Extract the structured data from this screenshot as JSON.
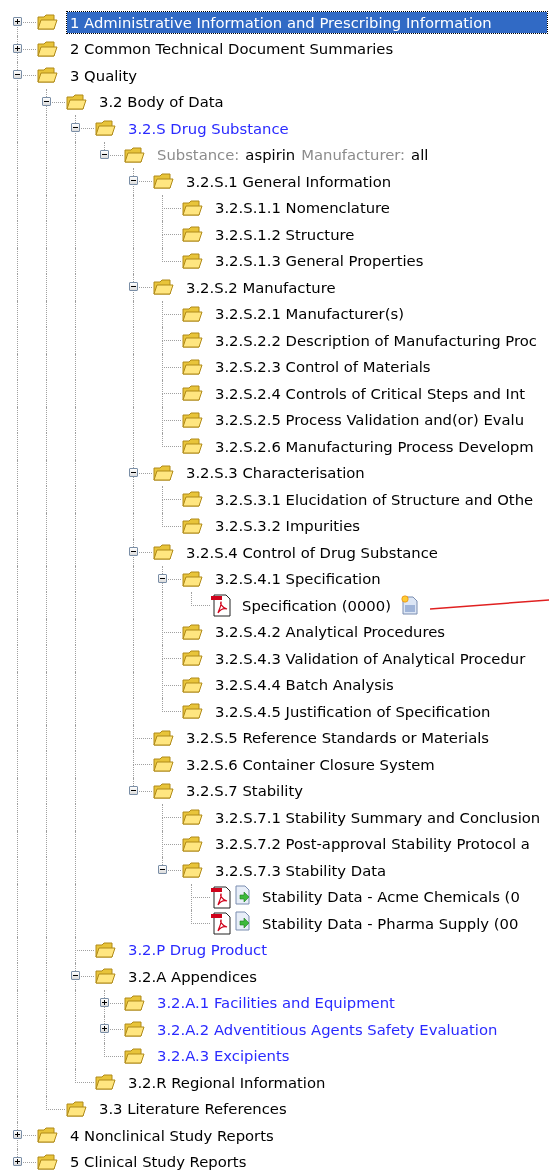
{
  "tree": [
    {
      "kind": "folder",
      "label": "1 Administrative Information and Prescribing Information",
      "selected": true,
      "emphasized": false,
      "expanded": false
    },
    {
      "kind": "folder",
      "label": "2 Common Technical Document Summaries",
      "selected": false,
      "emphasized": false,
      "expanded": false
    },
    {
      "kind": "folder",
      "label": "3 Quality",
      "selected": false,
      "emphasized": false,
      "expanded": true,
      "children": [
        {
          "kind": "folder",
          "label": "3.2 Body of Data",
          "selected": false,
          "emphasized": false,
          "expanded": true,
          "children": [
            {
              "kind": "folder",
              "label": "3.2.S Drug Substance",
              "selected": false,
              "emphasized": true,
              "expanded": true,
              "children": [
                {
                  "kind": "filter",
                  "selected": false,
                  "expanded": true,
                  "parts": [
                    {
                      "text": "Substance:",
                      "muted": true
                    },
                    {
                      "text": "aspirin",
                      "muted": false
                    },
                    {
                      "text": "Manufacturer:",
                      "muted": true
                    },
                    {
                      "text": "all",
                      "muted": false
                    }
                  ],
                  "children": [
                    {
                      "kind": "folder",
                      "label": "3.2.S.1 General Information",
                      "selected": false,
                      "emphasized": false,
                      "expanded": true,
                      "children": [
                        {
                          "kind": "folder",
                          "label": "3.2.S.1.1 Nomenclature",
                          "selected": false,
                          "emphasized": false
                        },
                        {
                          "kind": "folder",
                          "label": "3.2.S.1.2 Structure",
                          "selected": false,
                          "emphasized": false
                        },
                        {
                          "kind": "folder",
                          "label": "3.2.S.1.3 General Properties",
                          "selected": false,
                          "emphasized": false
                        }
                      ]
                    },
                    {
                      "kind": "folder",
                      "label": "3.2.S.2 Manufacture",
                      "selected": false,
                      "emphasized": false,
                      "expanded": true,
                      "children": [
                        {
                          "kind": "folder",
                          "label": "3.2.S.2.1 Manufacturer(s)",
                          "selected": false,
                          "emphasized": false
                        },
                        {
                          "kind": "folder",
                          "label": "3.2.S.2.2 Description of Manufacturing Proc",
                          "selected": false,
                          "emphasized": false
                        },
                        {
                          "kind": "folder",
                          "label": "3.2.S.2.3 Control of Materials",
                          "selected": false,
                          "emphasized": false
                        },
                        {
                          "kind": "folder",
                          "label": "3.2.S.2.4 Controls of Critical Steps and Int",
                          "selected": false,
                          "emphasized": false
                        },
                        {
                          "kind": "folder",
                          "label": "3.2.S.2.5 Process Validation and(or) Evalu",
                          "selected": false,
                          "emphasized": false
                        },
                        {
                          "kind": "folder",
                          "label": "3.2.S.2.6 Manufacturing Process Developm",
                          "selected": false,
                          "emphasized": false
                        }
                      ]
                    },
                    {
                      "kind": "folder",
                      "label": "3.2.S.3 Characterisation",
                      "selected": false,
                      "emphasized": false,
                      "expanded": true,
                      "children": [
                        {
                          "kind": "folder",
                          "label": "3.2.S.3.1 Elucidation of Structure and Othe",
                          "selected": false,
                          "emphasized": false
                        },
                        {
                          "kind": "folder",
                          "label": "3.2.S.3.2 Impurities",
                          "selected": false,
                          "emphasized": false
                        }
                      ]
                    },
                    {
                      "kind": "folder",
                      "label": "3.2.S.4 Control of Drug Substance",
                      "selected": false,
                      "emphasized": false,
                      "expanded": true,
                      "children": [
                        {
                          "kind": "folder",
                          "label": "3.2.S.4.1 Specification",
                          "selected": false,
                          "emphasized": false,
                          "expanded": true,
                          "children": [
                            {
                              "kind": "document",
                              "label": "Specification (0000)",
                              "selected": false,
                              "linked": false,
                              "flagged_new": true,
                              "annotated": true
                            }
                          ]
                        },
                        {
                          "kind": "folder",
                          "label": "3.2.S.4.2 Analytical Procedures",
                          "selected": false,
                          "emphasized": false
                        },
                        {
                          "kind": "folder",
                          "label": "3.2.S.4.3 Validation of Analytical Procedur",
                          "selected": false,
                          "emphasized": false
                        },
                        {
                          "kind": "folder",
                          "label": "3.2.S.4.4 Batch Analysis",
                          "selected": false,
                          "emphasized": false
                        },
                        {
                          "kind": "folder",
                          "label": "3.2.S.4.5 Justification of Specification",
                          "selected": false,
                          "emphasized": false
                        }
                      ]
                    },
                    {
                      "kind": "folder",
                      "label": "3.2.S.5 Reference Standards or Materials",
                      "selected": false,
                      "emphasized": false
                    },
                    {
                      "kind": "folder",
                      "label": "3.2.S.6 Container Closure System",
                      "selected": false,
                      "emphasized": false
                    },
                    {
                      "kind": "folder",
                      "label": "3.2.S.7 Stability",
                      "selected": false,
                      "emphasized": false,
                      "expanded": true,
                      "children": [
                        {
                          "kind": "folder",
                          "label": "3.2.S.7.1 Stability Summary and Conclusion",
                          "selected": false,
                          "emphasized": false
                        },
                        {
                          "kind": "folder",
                          "label": "3.2.S.7.2 Post-approval Stability Protocol a",
                          "selected": false,
                          "emphasized": false
                        },
                        {
                          "kind": "folder",
                          "label": "3.2.S.7.3 Stability Data",
                          "selected": false,
                          "emphasized": false,
                          "expanded": true,
                          "children": [
                            {
                              "kind": "document",
                              "label": "Stability Data - Acme Chemicals  (0",
                              "selected": false,
                              "linked": true,
                              "flagged_new": false,
                              "annotated": false
                            },
                            {
                              "kind": "document",
                              "label": "Stability Data - Pharma Supply  (00",
                              "selected": false,
                              "linked": true,
                              "flagged_new": false,
                              "annotated": false
                            }
                          ]
                        }
                      ]
                    }
                  ]
                }
              ]
            },
            {
              "kind": "folder",
              "label": "3.2.P Drug Product",
              "selected": false,
              "emphasized": true
            },
            {
              "kind": "folder",
              "label": "3.2.A Appendices",
              "selected": false,
              "emphasized": false,
              "expanded": true,
              "children": [
                {
                  "kind": "folder",
                  "label": "3.2.A.1 Facilities and Equipment",
                  "selected": false,
                  "emphasized": true,
                  "expanded": false
                },
                {
                  "kind": "folder",
                  "label": "3.2.A.2 Adventitious Agents Safety Evaluation",
                  "selected": false,
                  "emphasized": true,
                  "expanded": false
                },
                {
                  "kind": "folder",
                  "label": "3.2.A.3 Excipients",
                  "selected": false,
                  "emphasized": true
                }
              ]
            },
            {
              "kind": "folder",
              "label": "3.2.R Regional Information",
              "selected": false,
              "emphasized": false
            }
          ]
        },
        {
          "kind": "folder",
          "label": "3.3 Literature References",
          "selected": false,
          "emphasized": false
        }
      ]
    },
    {
      "kind": "folder",
      "label": "4 Nonclinical Study Reports",
      "selected": false,
      "emphasized": false,
      "expanded": false
    },
    {
      "kind": "folder",
      "label": "5 Clinical Study Reports",
      "selected": false,
      "emphasized": false,
      "expanded": false
    }
  ]
}
